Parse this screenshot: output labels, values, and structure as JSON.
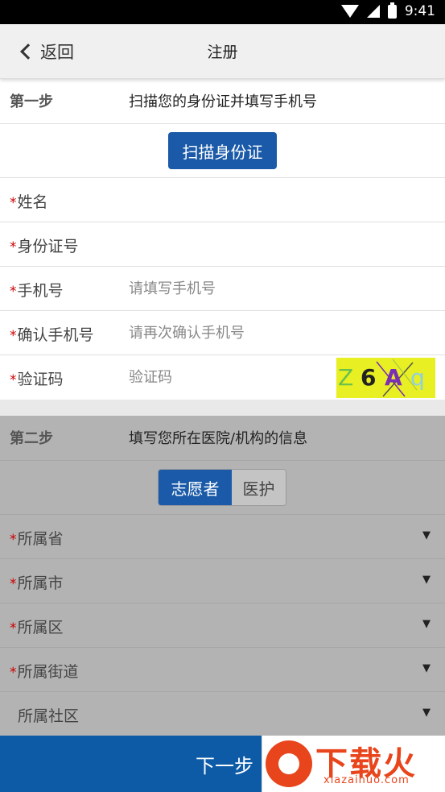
{
  "status_bar": {
    "time": "9:41"
  },
  "nav": {
    "back_label": "返回",
    "title": "注册"
  },
  "step1": {
    "step_label": "第一步",
    "description": "扫描您的身份证并填写手机号",
    "scan_button": "扫描身份证"
  },
  "fields1": {
    "name": {
      "label": "姓名"
    },
    "id_number": {
      "label": "身份证号"
    },
    "phone": {
      "label": "手机号",
      "placeholder": "请填写手机号"
    },
    "phone_confirm": {
      "label": "确认手机号",
      "placeholder": "请再次确认手机号"
    },
    "captcha": {
      "label": "验证码",
      "placeholder": "验证码",
      "image_text": "Z6Aq"
    }
  },
  "step2": {
    "step_label": "第二步",
    "description": "填写您所在医院/机构的信息",
    "role_options": [
      "志愿者",
      "医护"
    ],
    "selected_role": "志愿者"
  },
  "fields2": {
    "province": {
      "label": "所属省"
    },
    "city": {
      "label": "所属市"
    },
    "district": {
      "label": "所属区"
    },
    "street": {
      "label": "所属街道"
    },
    "community": {
      "label": "所属社区"
    }
  },
  "footer": {
    "next_button": "下一步",
    "watermark_text": "下载火",
    "watermark_url": "xiazaihuo.com"
  },
  "colors": {
    "primary": "#1a5aa8",
    "required_star": "#cc0000",
    "overlay": "#b3b3b3",
    "watermark": "#e8451c",
    "captcha_bg": "#e8ef22"
  },
  "icons": {
    "back": "chevron-left-icon",
    "dropdown": "triangle-down-icon"
  }
}
